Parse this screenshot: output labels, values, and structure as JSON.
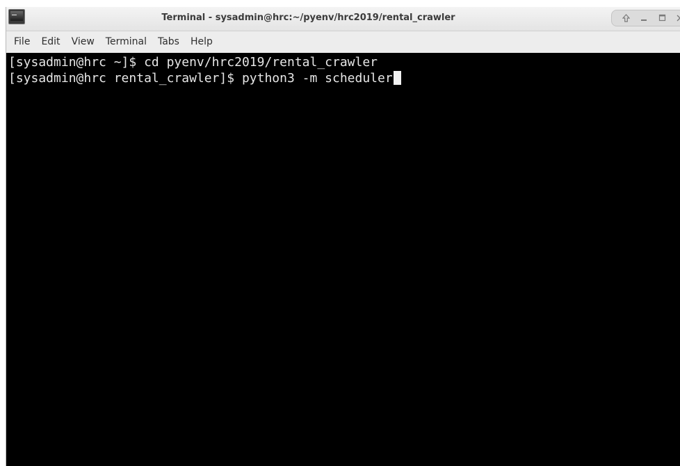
{
  "window": {
    "title": "Terminal - sysadmin@hrc:~/pyenv/hrc2019/rental_crawler",
    "app_icon": "terminal-app-icon",
    "controls": [
      "arrow-up-icon",
      "minimize-icon",
      "maximize-icon",
      "close-icon"
    ]
  },
  "menubar": {
    "items": [
      {
        "label": "File"
      },
      {
        "label": "Edit"
      },
      {
        "label": "View"
      },
      {
        "label": "Terminal"
      },
      {
        "label": "Tabs"
      },
      {
        "label": "Help"
      }
    ]
  },
  "terminal": {
    "background": "#000000",
    "foreground": "#e6e6e6",
    "lines": [
      {
        "prompt": "[sysadmin@hrc ~]$ ",
        "command": "cd pyenv/hrc2019/rental_crawler"
      },
      {
        "prompt": "[sysadmin@hrc rental_crawler]$ ",
        "command": "python3 -m scheduler"
      }
    ]
  }
}
